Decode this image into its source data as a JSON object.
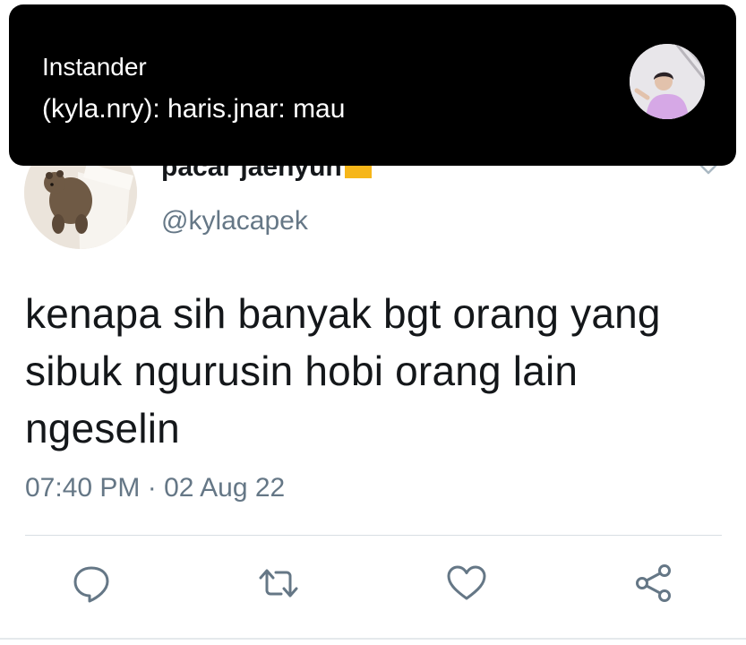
{
  "notification": {
    "app_name": "Instander",
    "message": "(kyla.nry): haris.jnar: mau",
    "avatar_icon": "user-photo-icon"
  },
  "tweet": {
    "display_name": "pacar jaehyun",
    "badge_icon": "yellow-square-emoji-icon",
    "handle": "@kylacapek",
    "text": "kenapa sih banyak bgt orang yang sibuk ngurusin hobi orang lain ngeselin",
    "time": "07:40 PM",
    "separator": "·",
    "date": "02 Aug 22",
    "avatar_icon": "bear-drawing-avatar-icon",
    "actions": [
      "reply-icon",
      "retweet-icon",
      "like-icon",
      "share-icon"
    ]
  },
  "colors": {
    "text_primary": "#14171a",
    "text_secondary": "#657786",
    "icon_gray": "#657786",
    "badge_yellow": "#f6b619",
    "notification_bg": "#000000"
  }
}
